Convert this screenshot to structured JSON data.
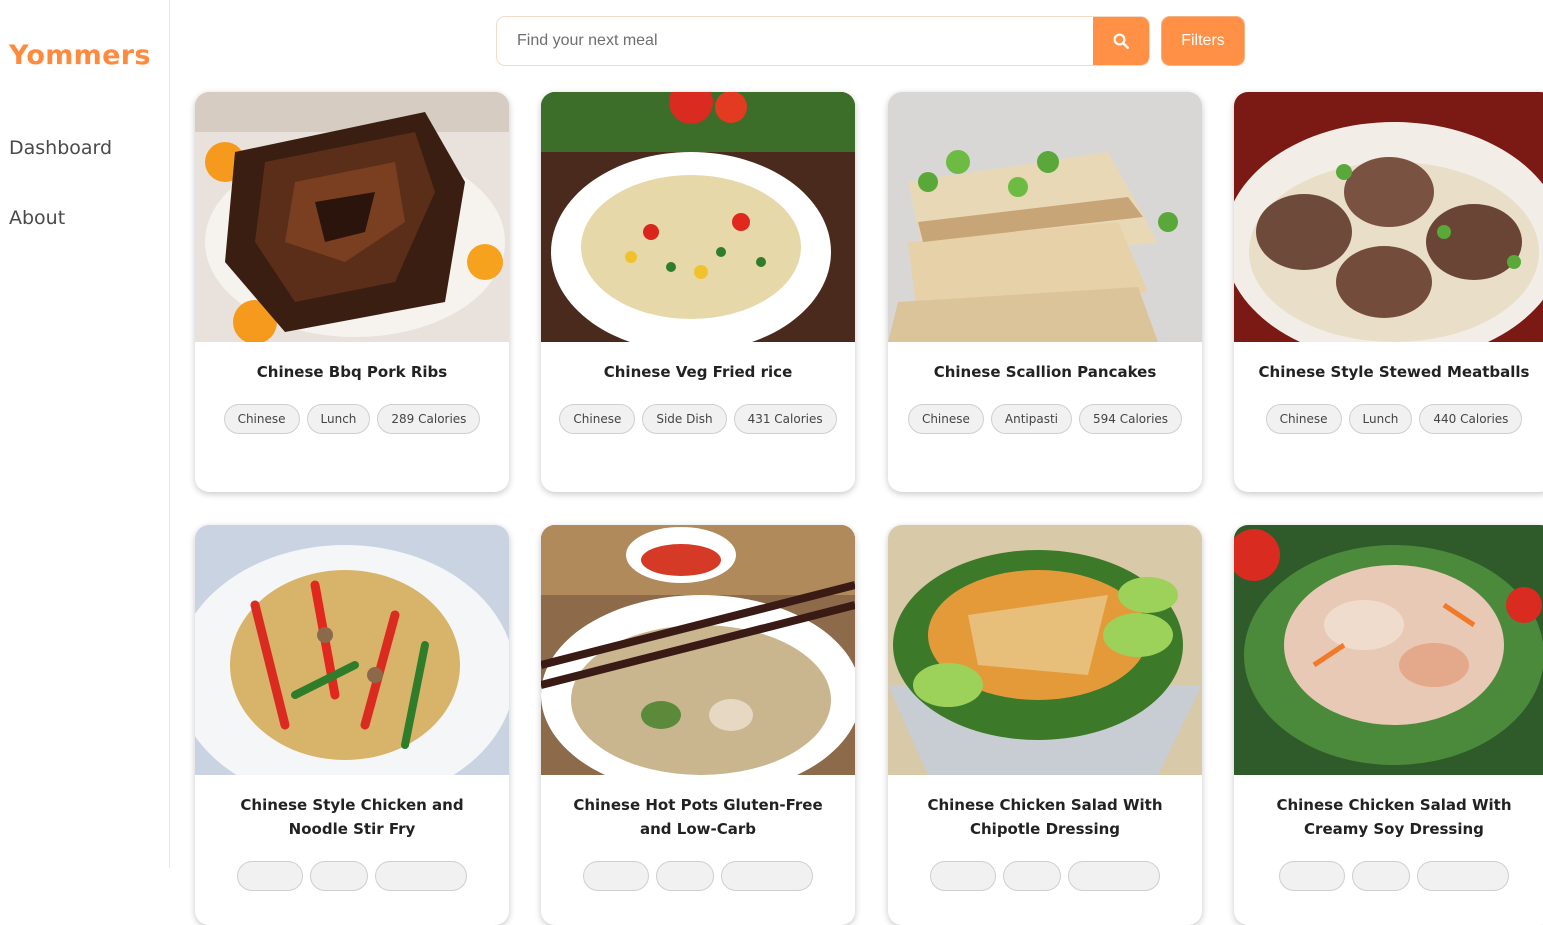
{
  "brand": {
    "name": "Yommers",
    "color": "#ff8a3d"
  },
  "nav": [
    {
      "label": "Dashboard"
    },
    {
      "label": "About"
    }
  ],
  "search": {
    "placeholder": "Find your next meal",
    "button_icon": "search-icon"
  },
  "filters": {
    "label": "Filters"
  },
  "recipes": [
    {
      "title": "Chinese Bbq Pork Ribs",
      "tags": [
        "Chinese",
        "Lunch",
        "289 Calories"
      ],
      "image": "ribs-photo"
    },
    {
      "title": "Chinese Veg Fried rice",
      "tags": [
        "Chinese",
        "Side Dish",
        "431 Calories"
      ],
      "image": "fried-rice-photo"
    },
    {
      "title": "Chinese Scallion Pancakes",
      "tags": [
        "Chinese",
        "Antipasti",
        "594 Calories"
      ],
      "image": "pancakes-photo"
    },
    {
      "title": "Chinese Style Stewed Meatballs",
      "tags": [
        "Chinese",
        "Lunch",
        "440 Calories"
      ],
      "image": "meatballs-photo"
    },
    {
      "title": "Chinese Style Chicken and Noodle Stir Fry",
      "tags": [
        "",
        "",
        ""
      ],
      "image": "noodles-photo"
    },
    {
      "title": "Chinese Hot Pots Gluten-Free and Low-Carb",
      "tags": [
        "",
        "",
        ""
      ],
      "image": "hot-pot-photo"
    },
    {
      "title": "Chinese Chicken Salad With Chipotle Dressing",
      "tags": [
        "",
        "",
        ""
      ],
      "image": "chipotle-salad-photo"
    },
    {
      "title": "Chinese Chicken Salad With Creamy Soy Dressing",
      "tags": [
        "",
        "",
        ""
      ],
      "image": "soy-salad-photo"
    }
  ]
}
